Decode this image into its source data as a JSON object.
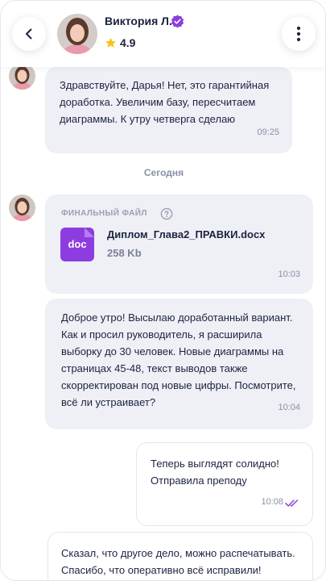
{
  "header": {
    "contact_name": "Виктория Л.",
    "rating": "4.9",
    "back_icon": "chevron-left-icon",
    "more_icon": "more-vertical-icon",
    "verified_icon": "verified-badge-icon",
    "star_icon": "star-icon"
  },
  "colors": {
    "accent_purple": "#8d3ddf",
    "incoming_bubble": "#eef0f6",
    "star": "#f6c21c",
    "read_check": "#8d3ddf"
  },
  "messages": [
    {
      "direction": "in",
      "text": "Здравствуйте, Дарья! Нет, это гарантийная доработка. Увеличим базу, пересчитаем диаграммы. К утру четверга сделаю",
      "time": "09:25"
    }
  ],
  "day_separator": "Сегодня",
  "file_message": {
    "label": "ФИНАЛЬНЫЙ ФАЙЛ",
    "file_type": "doc",
    "file_name": "Диплом_Глава2_ПРАВКИ.docx",
    "file_size": "258 Kb",
    "time": "10:03"
  },
  "message_2": {
    "text": "Доброе утро! Высылаю доработанный вариант. Как и просил руководитель, я расширила выборку до 30 человек. Новые диаграммы на страницах 45-48, текст выводов также скорректирован под новые цифры. Посмотрите, всё ли устраивает?",
    "time": "10:04"
  },
  "message_3": {
    "text": "Теперь выглядят солидно! Отправила преподу",
    "time": "10:08",
    "status_icon": "double-check-icon"
  },
  "message_4": {
    "text": "Сказал, что другое дело, можно распечатывать. Спасибо, что оперативно всё исправили!"
  }
}
